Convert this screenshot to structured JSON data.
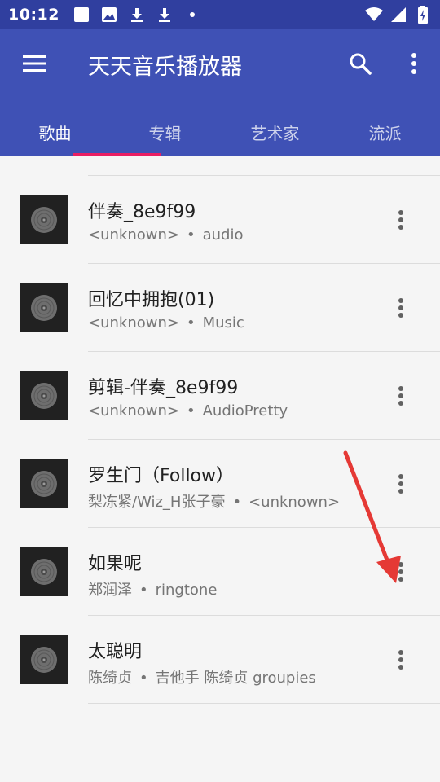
{
  "status_bar": {
    "time": "10:12",
    "left_icons": [
      "notification-square-icon",
      "image-icon",
      "download-icon",
      "download-icon",
      "dot-icon"
    ],
    "right_icons": [
      "wifi-icon",
      "signal-icon",
      "battery-charging-icon"
    ]
  },
  "app_bar": {
    "title": "天天音乐播放器",
    "menu_icon": "hamburger-menu-icon",
    "search_icon": "search-icon",
    "overflow_icon": "more-vert-icon"
  },
  "tabs": [
    {
      "label": "歌曲",
      "active": true
    },
    {
      "label": "专辑",
      "active": false
    },
    {
      "label": "艺术家",
      "active": false
    },
    {
      "label": "流派",
      "active": false
    }
  ],
  "songs": [
    {
      "title": "",
      "artist": "<unknown>",
      "separator": "•",
      "album": "Music"
    },
    {
      "title": "伴奏_8e9f99",
      "artist": "<unknown>",
      "separator": "•",
      "album": "audio"
    },
    {
      "title": "回忆中拥抱(01)",
      "artist": "<unknown>",
      "separator": "•",
      "album": "Music"
    },
    {
      "title": "剪辑-伴奏_8e9f99",
      "artist": "<unknown>",
      "separator": "•",
      "album": "AudioPretty"
    },
    {
      "title": "罗生门（Follow）",
      "artist": "梨冻紧/Wiz_H张子豪",
      "separator": "•",
      "album": "<unknown>"
    },
    {
      "title": "如果呢",
      "artist": "郑润泽",
      "separator": "•",
      "album": "ringtone"
    },
    {
      "title": "太聪明",
      "artist": "陈绮贞",
      "separator": "•",
      "album": "吉他手 陈绮贞 groupies"
    }
  ],
  "colors": {
    "status_bar": "#303f9f",
    "primary": "#3f51b5",
    "accent": "#e91e63",
    "annotation_arrow": "#e53935"
  }
}
